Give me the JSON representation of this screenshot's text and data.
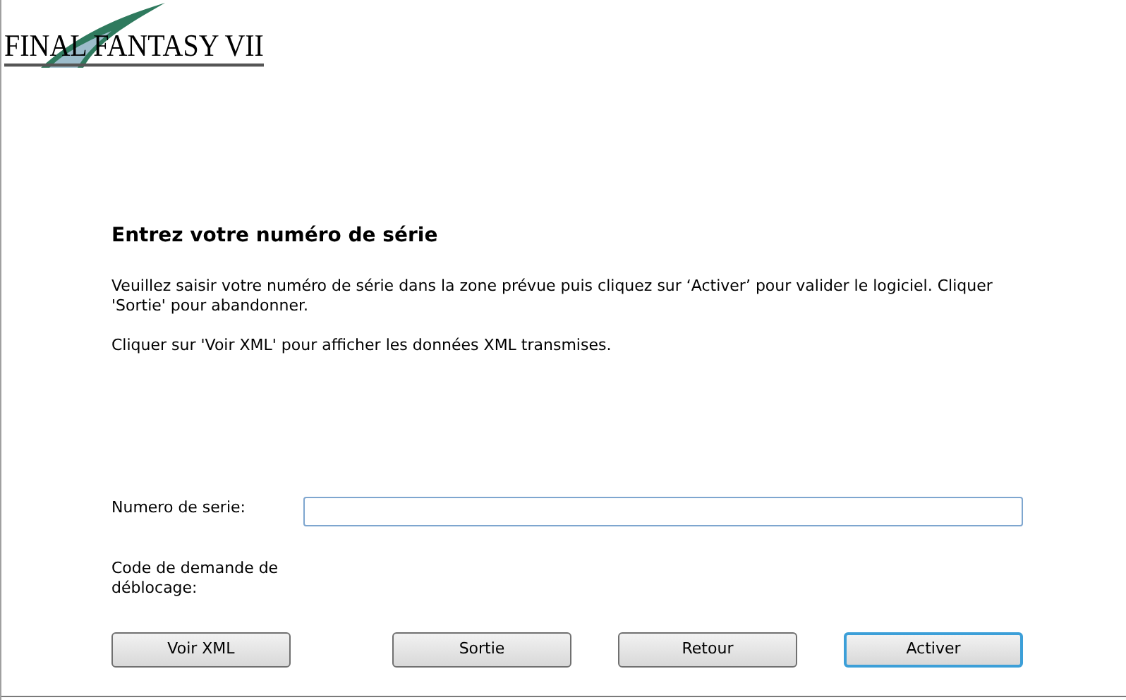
{
  "logo": {
    "text": "FINAL FANTASY VII"
  },
  "heading": "Entrez votre numéro de série",
  "paragraphs": [
    "Veuillez saisir votre numéro de série dans la zone prévue puis cliquez sur ‘Activer’ pour valider le logiciel. Cliquer 'Sortie' pour abandonner.",
    "Cliquer sur 'Voir XML' pour afficher les données XML transmises."
  ],
  "serial_field": {
    "label": "Numero de serie:"
  },
  "unlock_code": {
    "label": "Code de demande de déblocage:"
  },
  "buttons": [
    {
      "label": "Voir XML",
      "default": false
    },
    {
      "label": "Sortie",
      "default": false
    },
    {
      "label": "Retour",
      "default": false
    },
    {
      "label": "Activer",
      "default": true
    }
  ]
}
